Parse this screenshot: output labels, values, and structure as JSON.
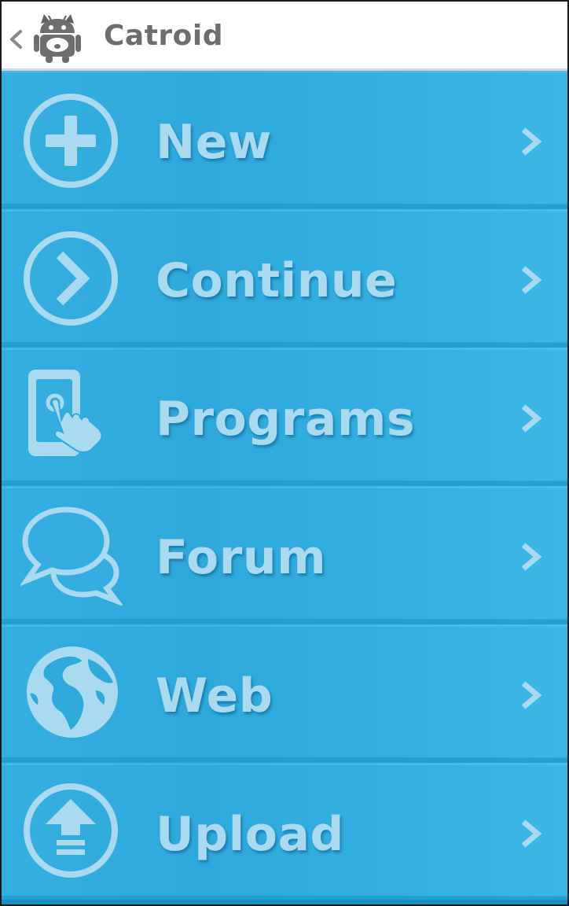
{
  "action_bar": {
    "title": "Catroid",
    "up_icon": "chevron-left-icon",
    "logo_icon": "catroid-robot-cat-icon",
    "background": "#ffffff",
    "title_color": "#6d6d6d"
  },
  "menu": {
    "background": "#1fa0d4",
    "label_color": "#a9daf0",
    "items": [
      {
        "label": "New",
        "icon": "plus-circle-icon"
      },
      {
        "label": "Continue",
        "icon": "chevron-circle-icon"
      },
      {
        "label": "Programs",
        "icon": "touch-phone-icon"
      },
      {
        "label": "Forum",
        "icon": "chat-bubbles-icon"
      },
      {
        "label": "Web",
        "icon": "globe-icon"
      },
      {
        "label": "Upload",
        "icon": "upload-circle-icon"
      }
    ]
  }
}
